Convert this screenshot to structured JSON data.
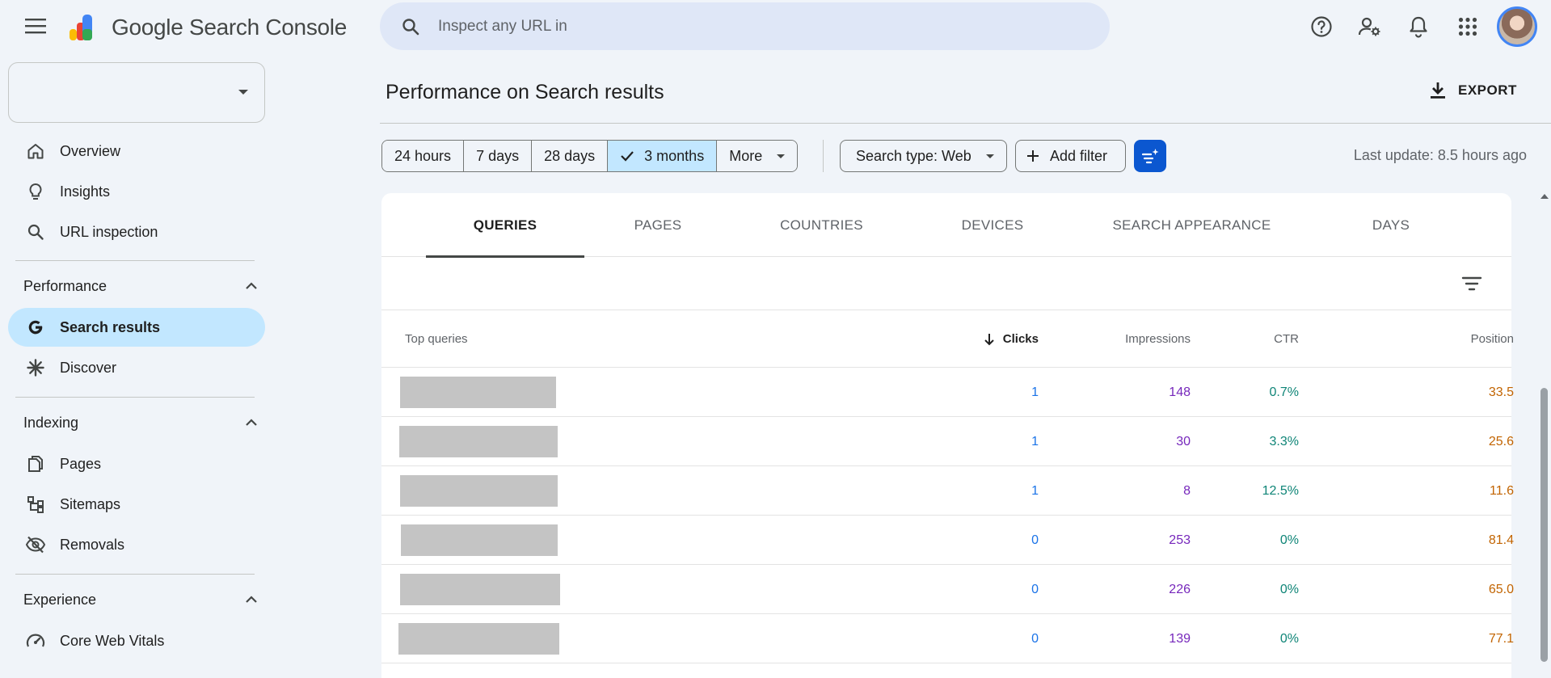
{
  "app": {
    "brand": "Google Search Console"
  },
  "search": {
    "placeholder": "Inspect any URL in"
  },
  "topbar_icons": [
    "help-icon",
    "manage-users-icon",
    "notifications-icon",
    "apps-grid-icon"
  ],
  "property_selector": {
    "value": ""
  },
  "sidebar": {
    "items": [
      {
        "label": "Overview",
        "icon": "home-icon"
      },
      {
        "label": "Insights",
        "icon": "lightbulb-icon"
      },
      {
        "label": "URL inspection",
        "icon": "search-icon"
      }
    ],
    "sections": [
      {
        "title": "Performance",
        "items": [
          {
            "label": "Search results",
            "icon": "google-g-icon",
            "active": true
          },
          {
            "label": "Discover",
            "icon": "asterisk-icon"
          }
        ]
      },
      {
        "title": "Indexing",
        "items": [
          {
            "label": "Pages",
            "icon": "pages-icon"
          },
          {
            "label": "Sitemaps",
            "icon": "sitemap-icon"
          },
          {
            "label": "Removals",
            "icon": "eye-off-icon"
          }
        ]
      },
      {
        "title": "Experience",
        "items": [
          {
            "label": "Core Web Vitals",
            "icon": "speedometer-icon"
          }
        ]
      }
    ]
  },
  "header": {
    "title": "Performance on Search results",
    "export_label": "EXPORT"
  },
  "filters": {
    "ranges": [
      "24 hours",
      "7 days",
      "28 days",
      "3 months",
      "More"
    ],
    "selected_range": "3 months",
    "search_type": "Search type: Web",
    "add_filter": "Add filter",
    "last_update": "Last update: 8.5 hours ago"
  },
  "tabs": [
    "QUERIES",
    "PAGES",
    "COUNTRIES",
    "DEVICES",
    "SEARCH APPEARANCE",
    "DAYS"
  ],
  "active_tab": "QUERIES",
  "table": {
    "columns": {
      "query": "Top queries",
      "clicks": "Clicks",
      "impressions": "Impressions",
      "ctr": "CTR",
      "position": "Position"
    },
    "sorted_by": "Clicks",
    "rows": [
      {
        "clicks": "1",
        "impressions": "148",
        "ctr": "0.7%",
        "position": "33.5"
      },
      {
        "clicks": "1",
        "impressions": "30",
        "ctr": "3.3%",
        "position": "25.6"
      },
      {
        "clicks": "1",
        "impressions": "8",
        "ctr": "12.5%",
        "position": "11.6"
      },
      {
        "clicks": "0",
        "impressions": "253",
        "ctr": "0%",
        "position": "81.4"
      },
      {
        "clicks": "0",
        "impressions": "226",
        "ctr": "0%",
        "position": "65.0"
      },
      {
        "clicks": "0",
        "impressions": "139",
        "ctr": "0%",
        "position": "77.1"
      }
    ]
  },
  "colors": {
    "clicks": "#1a73e8",
    "impressions": "#7627bb",
    "ctr": "#0f8577",
    "position": "#c26401",
    "selected": "#c2e7ff",
    "accent": "#0b57d0"
  }
}
